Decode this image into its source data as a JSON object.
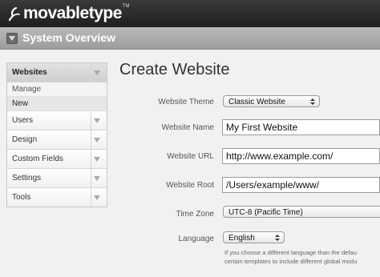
{
  "app": {
    "logo_text": "movabletype",
    "trademark": "TM"
  },
  "header": {
    "title": "System Overview",
    "toggle_icon": "caret-down-icon"
  },
  "sidebar": {
    "items": [
      {
        "label": "Websites",
        "icon": "chevron-down-icon",
        "active": true,
        "subitems": [
          {
            "label": "Manage"
          },
          {
            "label": "New",
            "current": true
          }
        ]
      },
      {
        "label": "Users",
        "icon": "chevron-down-icon"
      },
      {
        "label": "Design",
        "icon": "chevron-down-icon"
      },
      {
        "label": "Custom Fields",
        "icon": "chevron-down-icon"
      },
      {
        "label": "Settings",
        "icon": "chevron-down-icon"
      },
      {
        "label": "Tools",
        "icon": "chevron-down-icon"
      }
    ]
  },
  "main": {
    "title": "Create Website",
    "form": {
      "theme": {
        "label": "Website Theme",
        "value": "Classic Website"
      },
      "name": {
        "label": "Website Name",
        "value": "My First Website"
      },
      "url": {
        "label": "Website URL",
        "value": "http://www.example.com/"
      },
      "root": {
        "label": "Website Root",
        "value": "/Users/example/www/"
      },
      "timezone": {
        "label": "Time Zone",
        "value": "UTC-8 (Pacific Time)"
      },
      "language": {
        "label": "Language",
        "value": "English",
        "hint_line1": "If you choose a different language than the defau",
        "hint_line2": "certain templates to include different global modu"
      }
    }
  },
  "colors": {
    "topbar": "#2b2b2b",
    "subbar": "#a9a9a9",
    "background": "#f1f1f1"
  }
}
